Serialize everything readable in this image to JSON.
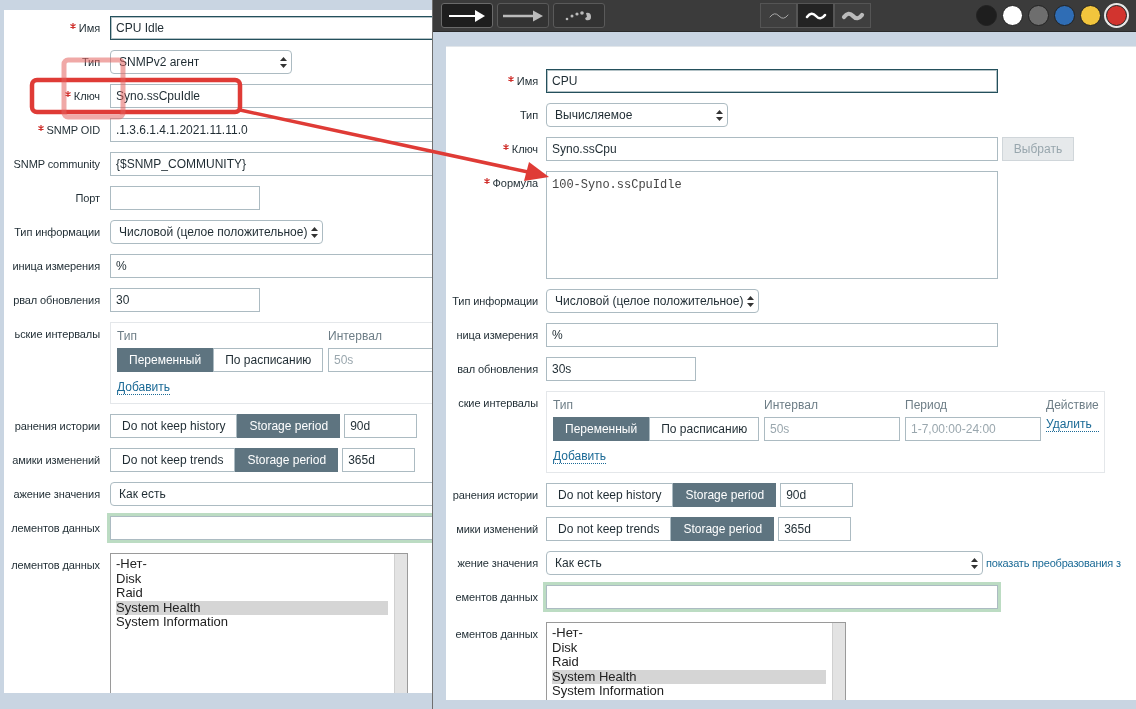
{
  "left_form": {
    "fields": [
      {
        "kind": "field",
        "label": "Имя",
        "required": true,
        "focused": true,
        "value": "CPU Idle"
      },
      {
        "kind": "select",
        "label": "Тип",
        "required": false,
        "focused": false,
        "value": "SNMPv2 агент"
      },
      {
        "kind": "field",
        "label": "Ключ",
        "required": true,
        "focused": false,
        "value": "Syno.ssCpuIdle"
      },
      {
        "kind": "field",
        "label": "SNMP OID",
        "required": true,
        "focused": false,
        "value": ".1.3.6.1.4.1.2021.11.11.0"
      },
      {
        "kind": "field",
        "label": "SNMP community",
        "required": false,
        "focused": false,
        "value": "{$SNMP_COMMUNITY}"
      },
      {
        "kind": "short-field",
        "label": "Порт",
        "required": false,
        "focused": false
      },
      {
        "kind": "select",
        "label": "Тип информации",
        "required": false,
        "focused": false,
        "value": "Числовой (целое положительное)"
      },
      {
        "kind": "field",
        "label": "иница измерения",
        "required": false,
        "focused": false,
        "value": "%"
      },
      {
        "kind": "short-field",
        "label": "рвал обновления",
        "required": false,
        "focused": false,
        "value": "30"
      },
      {
        "kind": "intervals",
        "label": "ьские интервалы",
        "required": false,
        "focused": false,
        "columns": [
          "Тип",
          "Интервал"
        ],
        "rows": [
          {
            "modes": [
              {
                "label": "Переменный",
                "selected": true
              },
              {
                "label": "По расписанию",
                "selected": false
              }
            ],
            "inputs": [
              {
                "placeholder": "50s"
              }
            ]
          }
        ],
        "add_link": "Добавить"
      },
      {
        "kind": "storage",
        "label": "ранения истории",
        "required": false,
        "focused": false,
        "options": [
          {
            "label": "Do not keep history",
            "selected": false
          },
          {
            "label": "Storage period",
            "selected": true
          }
        ],
        "value": "90d"
      },
      {
        "kind": "storage",
        "label": "амики изменений",
        "required": false,
        "focused": false,
        "options": [
          {
            "label": "Do not keep trends",
            "selected": false
          },
          {
            "label": "Storage period",
            "selected": true
          }
        ],
        "value": "365d"
      },
      {
        "kind": "wide-select",
        "label": "ажение значения",
        "required": false,
        "focused": false,
        "value": "Как есть"
      },
      {
        "kind": "group-field",
        "label": "лементов данных",
        "required": false,
        "focused": false
      },
      {
        "kind": "listbox",
        "label": "лементов данных",
        "required": false,
        "focused": false,
        "items": [
          {
            "label": "-Нет-",
            "selected": false
          },
          {
            "label": "Disk",
            "selected": false
          },
          {
            "label": "Raid",
            "selected": false
          },
          {
            "label": "System Health",
            "selected": true
          },
          {
            "label": "System Information",
            "selected": false
          }
        ]
      }
    ]
  },
  "toolbar": {
    "tools": [
      {
        "kind": "arrow",
        "selected": true
      },
      {
        "kind": "long-arrow",
        "selected": false
      },
      {
        "kind": "dots",
        "selected": false
      }
    ],
    "widths": [
      {
        "kind": "thin",
        "selected": false
      },
      {
        "kind": "medium",
        "selected": true
      },
      {
        "kind": "thick",
        "selected": false
      }
    ],
    "colors": [
      {
        "color": "#1e1e1e",
        "selected": false
      },
      {
        "color": "#ffffff",
        "selected": false
      },
      {
        "color": "#6e6e6e",
        "selected": false
      },
      {
        "color": "#2f6db5",
        "selected": false
      },
      {
        "color": "#f2c53d",
        "selected": false
      },
      {
        "color": "#d2342f",
        "selected": true
      }
    ]
  },
  "right_form": {
    "fields": [
      {
        "kind": "field",
        "label": "Имя",
        "required": true,
        "focused": true,
        "value": "CPU"
      },
      {
        "kind": "select",
        "label": "Тип",
        "required": false,
        "focused": false,
        "value": "Вычисляемое"
      },
      {
        "kind": "field",
        "label": "Ключ",
        "required": true,
        "focused": false,
        "value": "Syno.ssCpu",
        "button": {
          "label": "Выбрать",
          "disabled": true
        }
      },
      {
        "kind": "textarea",
        "label": "Формула",
        "required": true,
        "focused": false,
        "value": "100-Syno.ssCpuIdle"
      },
      {
        "kind": "select",
        "label": "Тип информации",
        "required": false,
        "focused": false,
        "value": "Числовой (целое положительное)"
      },
      {
        "kind": "field",
        "label": "ница измерения",
        "required": false,
        "focused": false,
        "value": "%"
      },
      {
        "kind": "short-field",
        "label": "вал обновления",
        "required": false,
        "focused": false,
        "value": "30s"
      },
      {
        "kind": "intervals",
        "label": "ские интервалы",
        "required": false,
        "focused": false,
        "columns": [
          "Тип",
          "Интервал",
          "Период",
          "Действие"
        ],
        "rows": [
          {
            "modes": [
              {
                "label": "Переменный",
                "selected": true
              },
              {
                "label": "По расписанию",
                "selected": false
              }
            ],
            "inputs": [
              {
                "placeholder": "50s"
              },
              {
                "placeholder": "1-7,00:00-24:00"
              }
            ],
            "action": "Удалить"
          }
        ],
        "add_link": "Добавить"
      },
      {
        "kind": "storage",
        "label": "ранения истории",
        "required": false,
        "focused": false,
        "options": [
          {
            "label": "Do not keep history",
            "selected": false
          },
          {
            "label": "Storage period",
            "selected": true
          }
        ],
        "value": "90d"
      },
      {
        "kind": "storage",
        "label": "мики изменений",
        "required": false,
        "focused": false,
        "options": [
          {
            "label": "Do not keep trends",
            "selected": false
          },
          {
            "label": "Storage period",
            "selected": true
          }
        ],
        "value": "365d"
      },
      {
        "kind": "wide-select",
        "label": "жение значения",
        "required": false,
        "focused": false,
        "value": "Как есть",
        "link": "показать преобразования з"
      },
      {
        "kind": "group-field",
        "label": "ементов данных",
        "required": false,
        "focused": false
      },
      {
        "kind": "listbox",
        "label": "ементов данных",
        "required": false,
        "focused": false,
        "items": [
          {
            "label": "-Нет-",
            "selected": false
          },
          {
            "label": "Disk",
            "selected": false
          },
          {
            "label": "Raid",
            "selected": false
          },
          {
            "label": "System Health",
            "selected": true
          },
          {
            "label": "System Information",
            "selected": false
          }
        ]
      }
    ]
  },
  "annotations": [
    {
      "kind": "frame"
    },
    {
      "kind": "square"
    },
    {
      "kind": "arrow"
    }
  ]
}
